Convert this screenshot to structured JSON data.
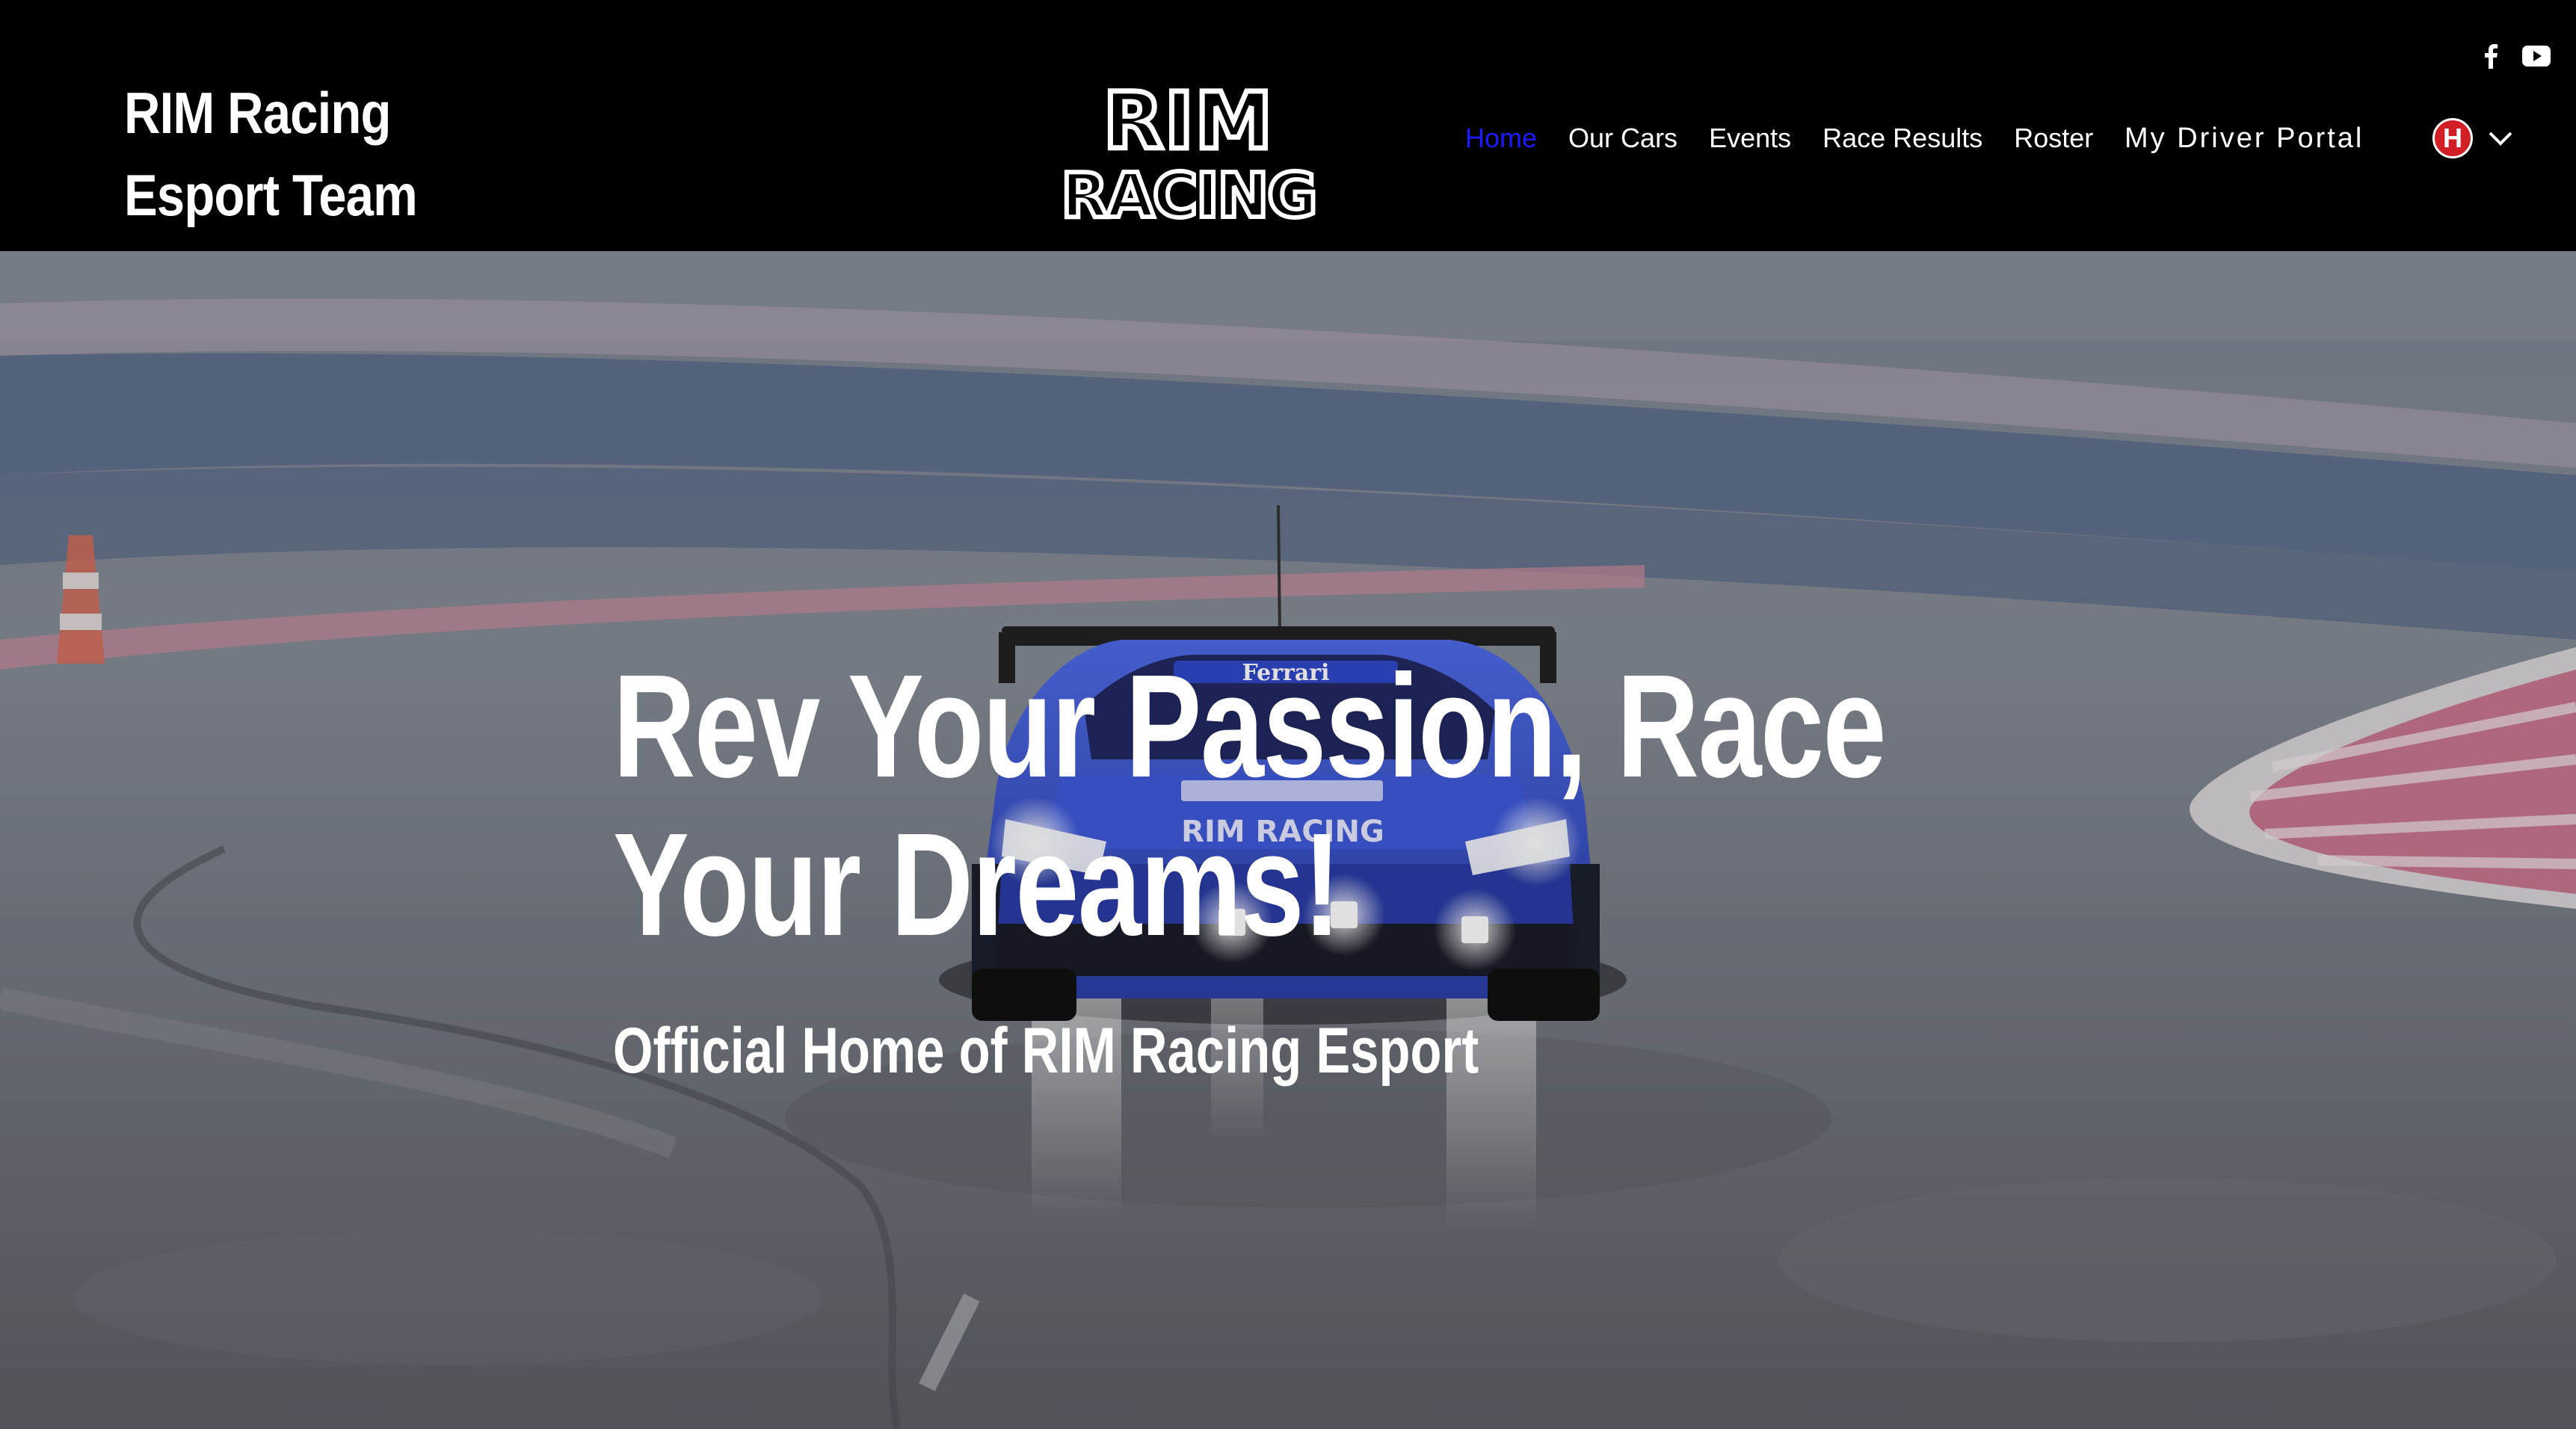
{
  "header": {
    "site_title_line1": "RIM Racing",
    "site_title_line2": "Esport Team",
    "logo_text_top": "RIM",
    "logo_text_bottom": "RACING",
    "nav": [
      {
        "label": "Home",
        "active": true
      },
      {
        "label": "Our Cars",
        "active": false
      },
      {
        "label": "Events",
        "active": false
      },
      {
        "label": "Race Results",
        "active": false
      },
      {
        "label": "Roster",
        "active": false
      }
    ],
    "portal_label": "My Driver Portal",
    "language_flag_letter": "H",
    "social_icons": [
      "facebook-icon",
      "youtube-icon"
    ]
  },
  "hero": {
    "heading_line1": "Rev Your Passion, Race",
    "heading_line2": "Your Dreams!",
    "subheading": "Official Home of RIM Racing Esport",
    "car_livery_text": "Ferrari",
    "car_badge_text": "RIM RACING"
  },
  "colors": {
    "header_bg": "#000000",
    "nav_active": "#1a1aff",
    "text": "#ffffff",
    "car_blue": "#3a55d6",
    "flag_red": "#d11f26"
  }
}
